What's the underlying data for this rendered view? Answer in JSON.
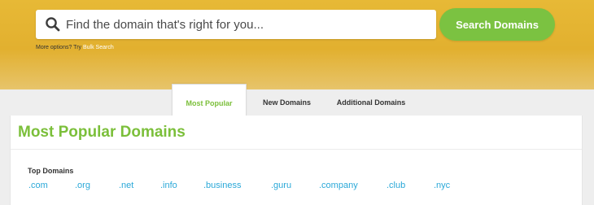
{
  "search": {
    "placeholder": "Find the domain that's right for you...",
    "button_label": "Search Domains",
    "more_options_prefix": "More options? Try",
    "bulk_search_link": "Bulk Search"
  },
  "tabs": [
    {
      "label": "Most Popular",
      "active": true
    },
    {
      "label": "New Domains",
      "active": false
    },
    {
      "label": "Additional Domains",
      "active": false
    }
  ],
  "main": {
    "section_title": "Most Popular Domains",
    "top_domains_label": "Top Domains",
    "tlds": [
      ".com",
      ".org",
      ".net",
      ".info",
      ".business",
      ".guru",
      ".company",
      ".club",
      ".nyc"
    ]
  },
  "colors": {
    "accent_green": "#7bc241",
    "hero_gold": "#e2b02f",
    "link_blue": "#2aa8d8"
  }
}
